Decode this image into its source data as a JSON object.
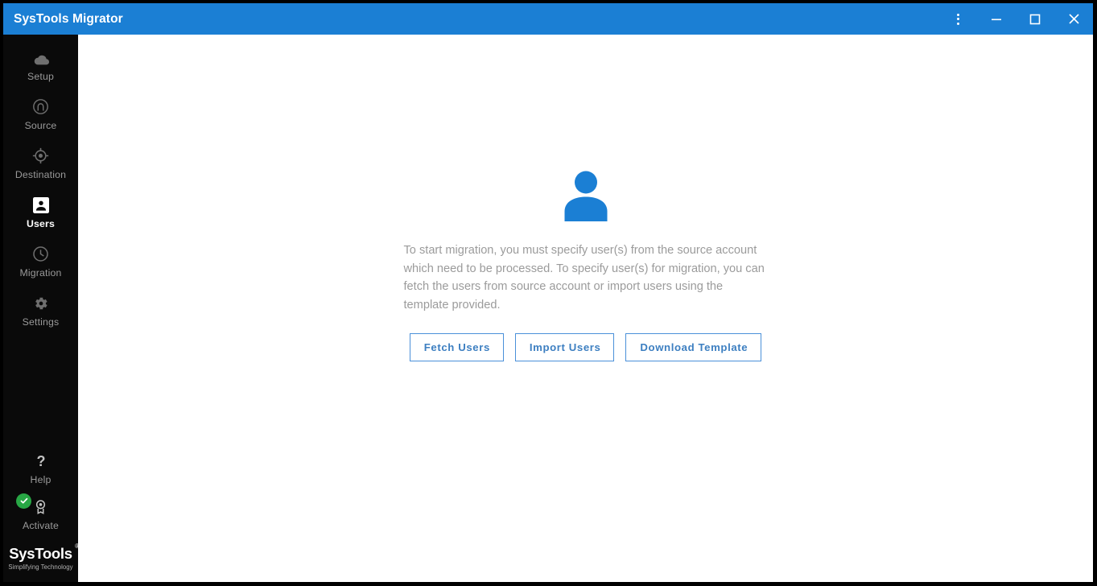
{
  "window": {
    "title": "SysTools Migrator",
    "accent_color": "#1b7fd4",
    "sidebar_color": "#0a0a0a",
    "controls": [
      {
        "name": "more-options",
        "label": "⋮"
      },
      {
        "name": "minimize",
        "label": "—"
      },
      {
        "name": "maximize",
        "label": "□"
      },
      {
        "name": "close",
        "label": "✕"
      }
    ]
  },
  "sidebar": {
    "items": [
      {
        "label": "Setup",
        "icon": "cloud-icon",
        "active": false
      },
      {
        "label": "Source",
        "icon": "source-arch-icon",
        "active": false
      },
      {
        "label": "Destination",
        "icon": "target-icon",
        "active": false
      },
      {
        "label": "Users",
        "icon": "account-box-icon",
        "active": true
      },
      {
        "label": "Migration",
        "icon": "clock-icon",
        "active": false
      },
      {
        "label": "Settings",
        "icon": "gear-icon",
        "active": false
      }
    ],
    "bottom_items": [
      {
        "label": "Help",
        "icon": "question-mark-icon"
      },
      {
        "label": "Activate",
        "icon": "badge-icon",
        "status": "activated",
        "status_color": "#28a745"
      }
    ],
    "logo": {
      "name": "SysTools",
      "registered_mark": "®",
      "tagline": "Simplifying Technology"
    }
  },
  "main": {
    "hero_icon": "user-avatar-icon",
    "hero_icon_color": "#1b7fd4",
    "message": "To start migration, you must specify user(s) from the source account which need to be processed. To specify user(s) for migration, you can fetch the users from source account or import users using the template provided.",
    "buttons": [
      {
        "label": "Fetch Users",
        "name": "fetch-users-button"
      },
      {
        "label": "Import Users",
        "name": "import-users-button"
      },
      {
        "label": "Download Template",
        "name": "download-template-button"
      }
    ],
    "button_color": "#3d7fc1",
    "button_border_color": "#4a90d9"
  }
}
